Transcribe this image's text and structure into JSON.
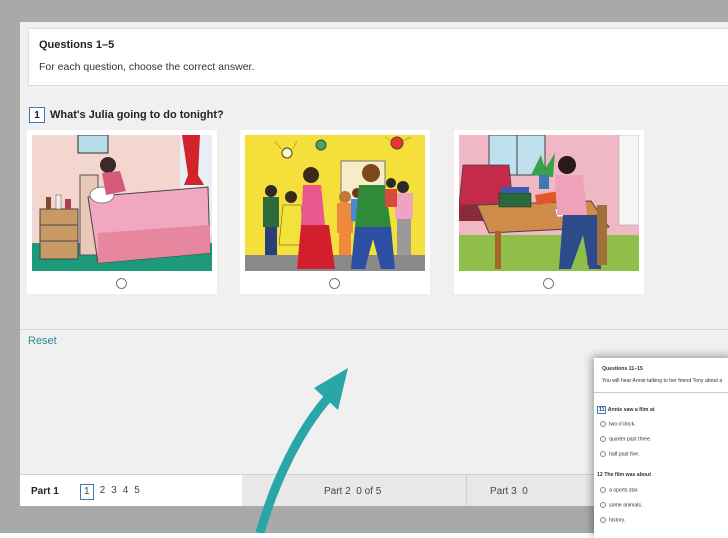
{
  "instructions": {
    "title": "Questions 1–5",
    "text": "For each question, choose the correct answer."
  },
  "question": {
    "number": "1",
    "text": "What's Julia going to do tonight?",
    "options": [
      "bed",
      "party",
      "study"
    ]
  },
  "reset_label": "Reset",
  "footer": {
    "part1_label": "Part 1",
    "part1_pages": [
      "1",
      "2",
      "3",
      "4",
      "5"
    ],
    "part2_label": "Part 2",
    "part2_status": "0 of 5",
    "part3_label": "Part 3",
    "part3_status": "0"
  },
  "thumbnail": {
    "title": "Questions 11–15",
    "subtitle": "You will hear Annie talking to her friend Tony about a",
    "q11_number": "11",
    "q11_text": "Annie saw a film at",
    "q11_options": [
      "two o'clock.",
      "quarter past three.",
      "half past five."
    ],
    "q12_number": "12",
    "q12_text": "The film was about",
    "q12_options": [
      "a sports star.",
      "some animals.",
      "history."
    ]
  },
  "colors": {
    "accent": "#2a8a9c",
    "box_border": "#3a7bbf",
    "arrow": "#2ba6a6"
  }
}
